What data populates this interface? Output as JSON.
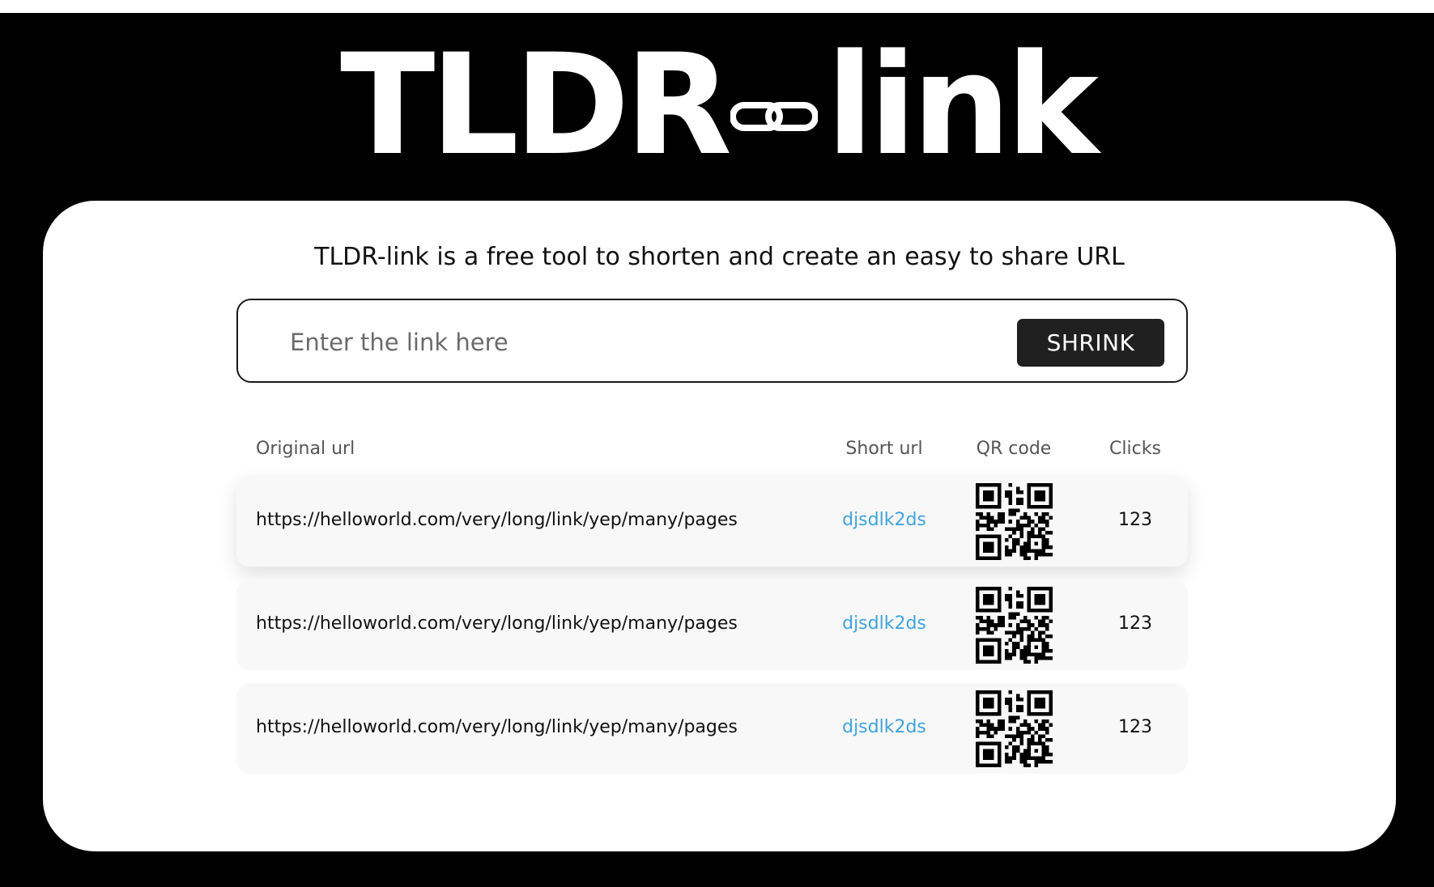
{
  "logo": {
    "part1": "TLDR",
    "part2": "link"
  },
  "tagline": "TLDR-link is a free tool to shorten and create an easy to share URL",
  "search": {
    "placeholder": "Enter the link here",
    "value": "",
    "button_label": "SHRINK"
  },
  "table": {
    "headers": {
      "original": "Original url",
      "short": "Short url",
      "qr": "QR code",
      "clicks": "Clicks"
    },
    "rows": [
      {
        "original": "https://helloworld.com/very/long/link/yep/many/pages",
        "short": "djsdlk2ds",
        "clicks": "123"
      },
      {
        "original": "https://helloworld.com/very/long/link/yep/many/pages",
        "short": "djsdlk2ds",
        "clicks": "123"
      },
      {
        "original": "https://helloworld.com/very/long/link/yep/many/pages",
        "short": "djsdlk2ds",
        "clicks": "123"
      }
    ]
  },
  "colors": {
    "background": "#000000",
    "card": "#ffffff",
    "button": "#202020",
    "short_link": "#3fa3e0",
    "row_background": "#f8f8f8"
  },
  "icons": {
    "logo_separator": "chain-link-icon",
    "qr": "qr-code-icon"
  }
}
